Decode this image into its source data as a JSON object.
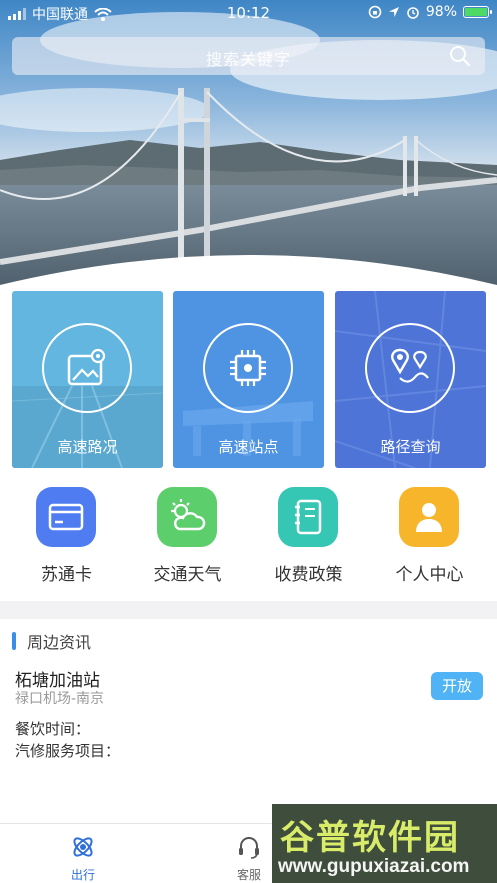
{
  "status_bar": {
    "carrier": "中国联通",
    "time": "10:12",
    "battery_text": "98%",
    "battery_level": 0.98,
    "icons": [
      "signal-icon",
      "wifi-icon",
      "rotation-lock-icon",
      "location-icon",
      "alarm-icon",
      "battery-icon"
    ]
  },
  "search": {
    "placeholder": "搜索关键字",
    "icon": "search-icon"
  },
  "feature_tiles": [
    {
      "label": "高速路况",
      "icon": "map-pin-image-icon",
      "color": "#5fb2de"
    },
    {
      "label": "高速站点",
      "icon": "chip-icon",
      "color": "#4f93e3"
    },
    {
      "label": "路径查询",
      "icon": "route-icon",
      "color": "#4d74d6"
    }
  ],
  "quick_links": [
    {
      "label": "苏通卡",
      "icon": "card-icon",
      "color": "#4f7cf0"
    },
    {
      "label": "交通天气",
      "icon": "weather-icon",
      "color": "#5cce6b"
    },
    {
      "label": "收费政策",
      "icon": "notebook-icon",
      "color": "#35c6b4"
    },
    {
      "label": "个人中心",
      "icon": "user-icon",
      "color": "#f7b52c"
    }
  ],
  "news": {
    "section_title": "周边资讯",
    "station_name": "柘塘加油站",
    "station_location": "禄口机场-南京",
    "status_button": "开放",
    "dining_label": "餐饮时间：",
    "repair_label": "汽修服务项目："
  },
  "tabbar": {
    "active_color": "#2f6fd9",
    "tabs": [
      {
        "label": "出行",
        "icon": "atom-icon",
        "active": true
      },
      {
        "label": "客服",
        "icon": "headset-icon",
        "active": false
      }
    ]
  },
  "watermark": {
    "brand": "谷普软件园",
    "url": "www.gupuxiazai.com"
  }
}
